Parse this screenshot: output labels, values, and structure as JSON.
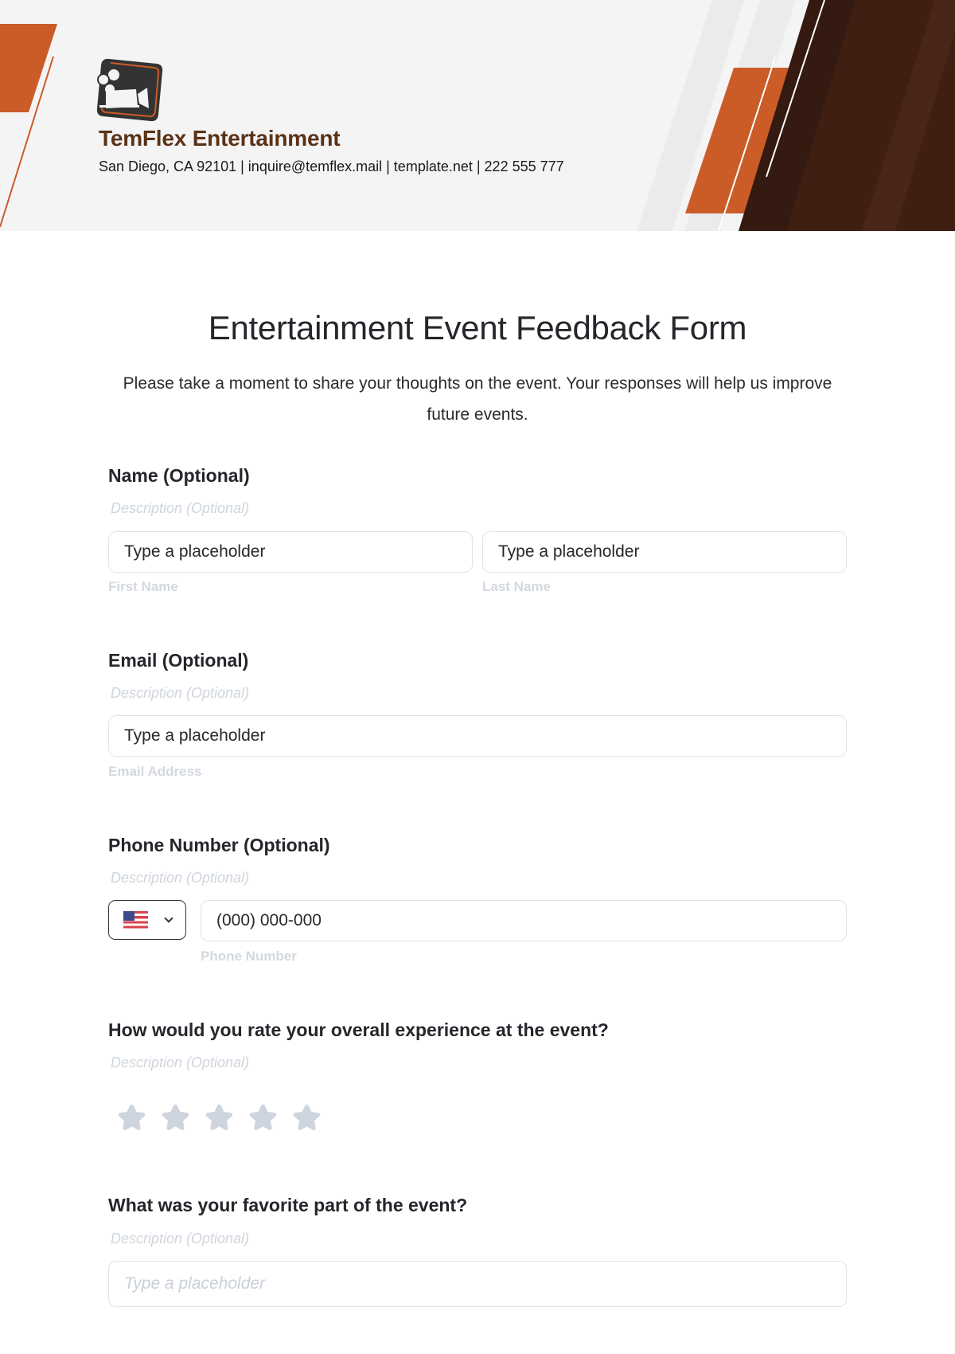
{
  "header": {
    "company_name": "TemFlex Entertainment",
    "contact_line": "San Diego, CA 92101 | inquire@temflex.mail | template.net | 222 555 777",
    "logo_icon": "movie-camera-icon",
    "colors": {
      "accent": "#cb5c28",
      "brand_dark": "#3f1f12",
      "company_text": "#5a3216"
    }
  },
  "form": {
    "title": "Entertainment Event Feedback Form",
    "intro": "Please take a moment to share your thoughts on the event. Your responses will help us improve future events.",
    "questions": [
      {
        "label": "Name (Optional)",
        "description": "Description (Optional)",
        "fields": [
          {
            "value": "Type a placeholder",
            "sublabel": "First Name"
          },
          {
            "value": "Type a placeholder",
            "sublabel": "Last Name"
          }
        ]
      },
      {
        "label": "Email (Optional)",
        "description": "Description (Optional)",
        "fields": [
          {
            "value": "Type a placeholder",
            "sublabel": "Email Address"
          }
        ]
      },
      {
        "label": "Phone Number (Optional)",
        "description": "Description (Optional)",
        "country_flag": "us-flag-icon",
        "fields": [
          {
            "value": "(000) 000-000",
            "sublabel": "Phone Number"
          }
        ]
      },
      {
        "label": "How would you rate your overall experience at the event?",
        "description": "Description (Optional)",
        "rating": {
          "max": 5,
          "value": 0
        }
      },
      {
        "label": "What was your favorite part of the event?",
        "description": "Description (Optional)",
        "fields": [
          {
            "placeholder": "Type a placeholder"
          }
        ]
      }
    ]
  }
}
